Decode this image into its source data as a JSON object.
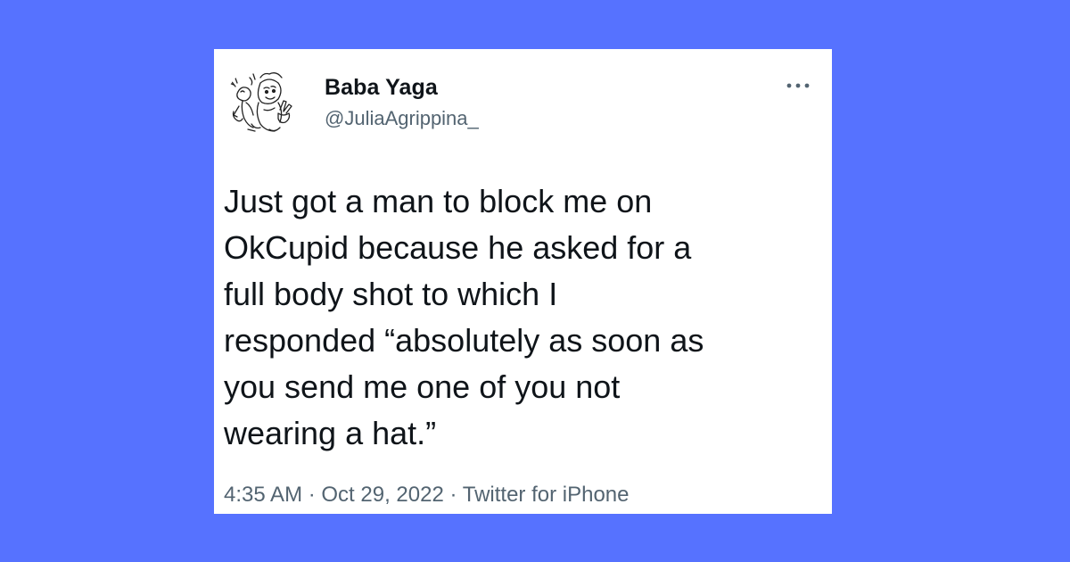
{
  "page": {
    "background_color": "#5672ff",
    "card_color": "#ffffff"
  },
  "tweet": {
    "author": {
      "display_name": "Baba Yaga",
      "handle": "@JuliaAgrippina_",
      "avatar_icon": "cartoon-sketch-avatar"
    },
    "more_icon": "more-options-icon",
    "text": "Just got a man to block me on\nOkCupid because he asked for a\nfull body shot to which I\nresponded “absolutely as soon as\nyou send me one of you not\nwearing a hat.”",
    "time": "4:35 AM",
    "date": "Oct 29, 2022",
    "source": "Twitter for iPhone",
    "separator": " · ",
    "text_color": "#0f1419",
    "secondary_color": "#536471"
  }
}
